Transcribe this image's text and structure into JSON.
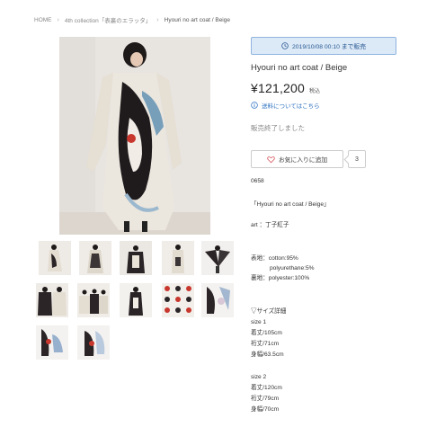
{
  "breadcrumb": {
    "home": "HOME",
    "category": "4th collection「表裏のエラッタ」",
    "current": "Hyouri no art coat / Beige"
  },
  "sale": {
    "banner": "2019/10/08 00:10 まで販売"
  },
  "product": {
    "title": "Hyouri no art coat / Beige",
    "price": "¥121,200",
    "tax_label": "税込",
    "shipping_link": "送料についてはこちら",
    "status": "販売終了しました",
    "favorite_label": "お気に入りに追加",
    "favorite_count": "3"
  },
  "description": {
    "lines": [
      "0658",
      "「Hyouri no art coat / Beige」",
      "art ：丁子紅子",
      "表地：cotton:95%",
      "polyurethane:5%",
      "裏地：polyester:100%",
      "▽サイズ詳細",
      "size 1",
      "着丈/105cm",
      "裄丈/71cm",
      "身幅/63.5cm",
      "size 2",
      "着丈/120cm",
      "裄丈/79cm",
      "身幅/70cm"
    ]
  },
  "colors": {
    "banner_bg": "#dce9f7",
    "banner_border": "#8fb4de",
    "link": "#2a6fc0"
  }
}
